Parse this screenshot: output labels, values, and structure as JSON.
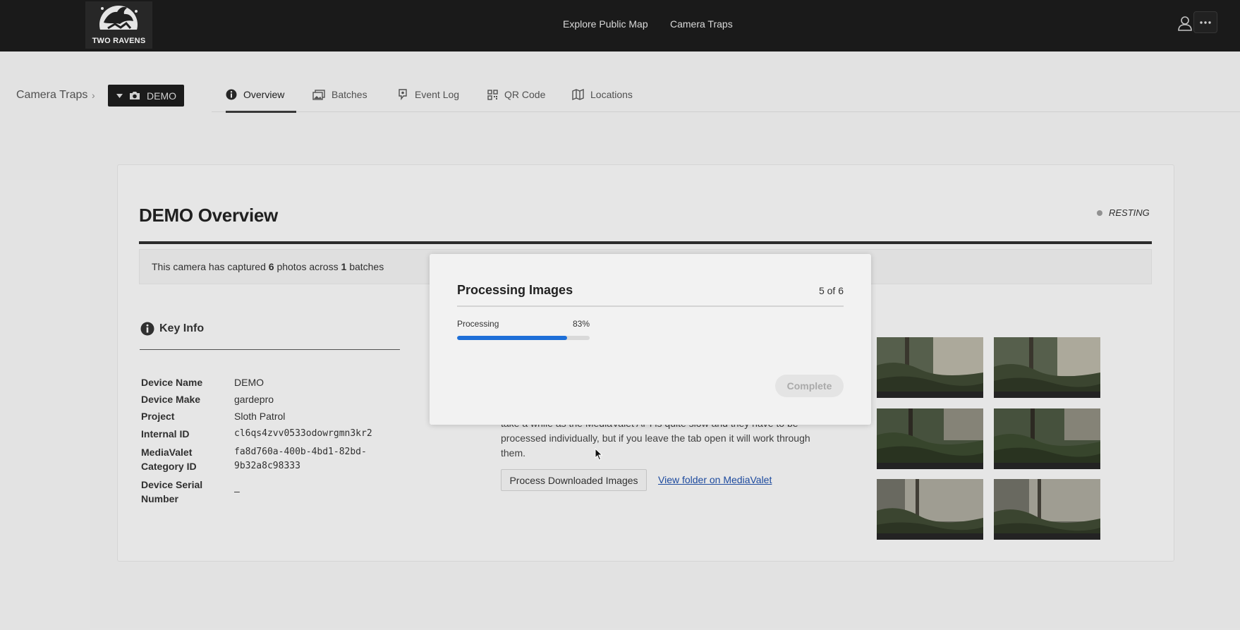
{
  "header": {
    "logo_text": "TWO RAVENS",
    "nav": [
      "Explore Public Map",
      "Camera Traps"
    ],
    "user_icon": "user-icon",
    "more_icon": "ellipsis-icon"
  },
  "breadcrumb": {
    "root": "Camera Traps",
    "current_camera": "DEMO"
  },
  "tabs": [
    {
      "label": "Overview",
      "icon": "info-circle-icon",
      "active": true
    },
    {
      "label": "Batches",
      "icon": "images-icon",
      "active": false
    },
    {
      "label": "Event Log",
      "icon": "map-pin-icon",
      "active": false
    },
    {
      "label": "QR Code",
      "icon": "qrcode-icon",
      "active": false
    },
    {
      "label": "Locations",
      "icon": "map-icon",
      "active": false
    }
  ],
  "overview": {
    "title": "DEMO Overview",
    "status": "RESTING",
    "status_color": "#9a9a9a",
    "summary_prefix": "This camera has captured",
    "photo_count": "6",
    "summary_middle": "photos across",
    "batch_count": "1",
    "summary_suffix": "batches"
  },
  "key_info": {
    "heading": "Key Info",
    "rows": [
      {
        "label": "Device Name",
        "value": "DEMO"
      },
      {
        "label": "Device Make",
        "value": "gardepro"
      },
      {
        "label": "Project",
        "value": "Sloth Patrol"
      },
      {
        "label": "Internal ID",
        "value": "cl6qs4zvv0533odowrgmn3kr2"
      },
      {
        "label_line1": "MediaValet",
        "label_line2": "Category ID",
        "value_line1": "fa8d760a-400b-4bd1-82bd-",
        "value_line2": "9b32a8c98333"
      },
      {
        "label_line1": "Device Serial",
        "label_line2": "Number",
        "value": "–"
      }
    ]
  },
  "mediavalet": {
    "desc_line1": "take a while as the MediaValet API is quite slow and they have to be",
    "desc_line2": "processed individually, but if you leave the tab open it will work through",
    "desc_line3": "them.",
    "process_button": "Process Downloaded Images",
    "link": "View folder on MediaValet"
  },
  "thumbnails_count": 6,
  "modal": {
    "title": "Processing Images",
    "count": "5 of 6",
    "progress_label": "Processing",
    "progress_text": "83%",
    "progress_value": 0.83,
    "progress_color": "#1e6fd8",
    "complete_button": "Complete"
  }
}
